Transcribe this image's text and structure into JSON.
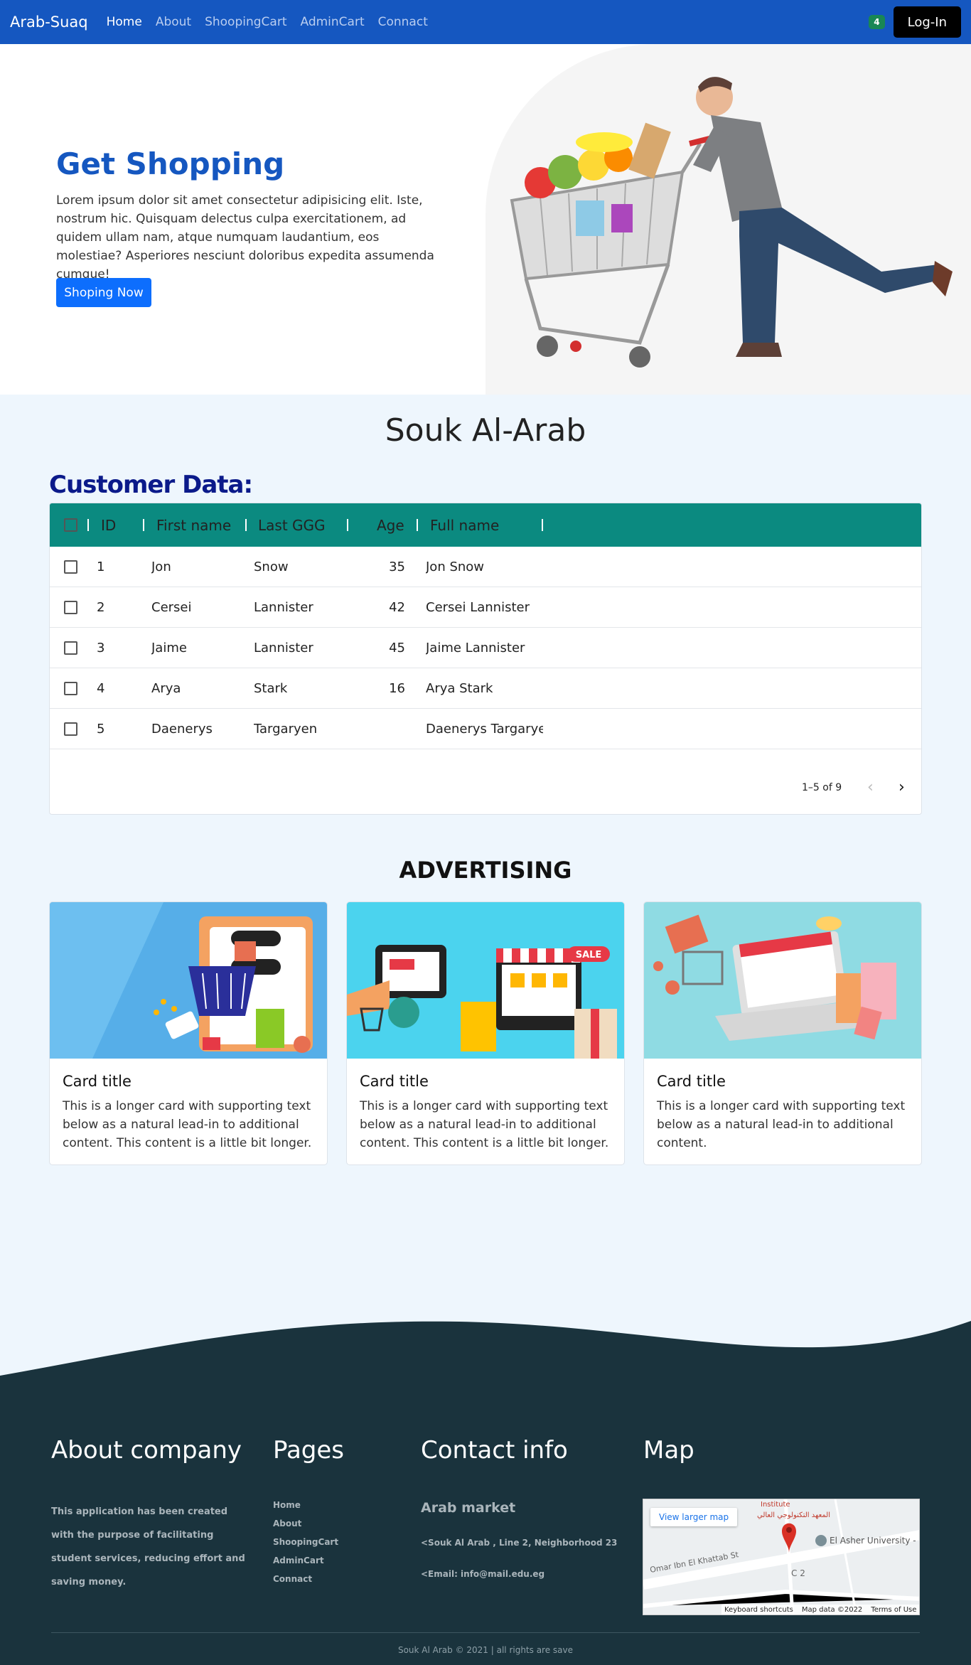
{
  "nav": {
    "brand": "Arab-Suaq",
    "links": [
      "Home",
      "About",
      "ShoopingCart",
      "AdminCart",
      "Connact"
    ],
    "cart_count": "4",
    "login": "Log-In"
  },
  "hero": {
    "title": "Get Shopping",
    "text": "Lorem ipsum dolor sit amet consectetur adipisicing elit. Iste, nostrum hic. Quisquam delectus culpa exercitationem, ad quidem ullam nam, atque numquam laudantium, eos molestiae? Asperiores nesciunt doloribus expedita assumenda cumque!",
    "button": "Shoping Now"
  },
  "section_title": "Souk Al-Arab",
  "customer": {
    "title": "Customer Data:",
    "columns": [
      "ID",
      "First name",
      "Last GGG",
      "Age",
      "Full name"
    ],
    "rows": [
      {
        "id": "1",
        "first": "Jon",
        "last": "Snow",
        "age": "35",
        "full": "Jon Snow"
      },
      {
        "id": "2",
        "first": "Cersei",
        "last": "Lannister",
        "age": "42",
        "full": "Cersei Lannister"
      },
      {
        "id": "3",
        "first": "Jaime",
        "last": "Lannister",
        "age": "45",
        "full": "Jaime Lannister"
      },
      {
        "id": "4",
        "first": "Arya",
        "last": "Stark",
        "age": "16",
        "full": "Arya Stark"
      },
      {
        "id": "5",
        "first": "Daenerys",
        "last": "Targaryen",
        "age": "",
        "full": "Daenerys Targaryen"
      }
    ],
    "pagination": "1–5 of 9"
  },
  "advertising": {
    "title": "ADVERTISING",
    "cards": [
      {
        "title": "Card title",
        "text": "This is a longer card with supporting text below as a natural lead-in to additional content. This content is a little bit longer.",
        "image": "shopping-basket-illustration"
      },
      {
        "title": "Card title",
        "text": "This is a longer card with supporting text below as a natural lead-in to additional content. This content is a little bit longer.",
        "image": "online-store-illustration",
        "badge": "SALE"
      },
      {
        "title": "Card title",
        "text": "This is a longer card with supporting text below as a natural lead-in to additional content.",
        "image": "laptop-shopping-illustration"
      }
    ]
  },
  "footer": {
    "about_heading": "About company",
    "about_text": "This application has been created with the purpose of facilitating student services, reducing effort and saving money.",
    "pages_heading": "Pages",
    "pages": [
      "Home",
      "About",
      "ShoopingCart",
      "AdminCart",
      "Connact"
    ],
    "contact_heading": "Contact info",
    "contact_name": "Arab market",
    "address": "<Souk Al Arab , Line 2, Neighborhood 23",
    "email": "<Email: info@mail.edu.eg",
    "map_heading": "Map",
    "map": {
      "larger": "View larger map",
      "place_ar": "المعهد التكنولوجي العالي",
      "place_top": "Institute",
      "uni": "El Asher University - EAU",
      "street": "Omar Ibn El Khattab St",
      "c2": "C 2",
      "shortcuts": "Keyboard shortcuts",
      "mapdata": "Map data ©2022",
      "terms": "Terms of Use"
    },
    "copyright": "Souk Al Arab © 2021 | all rights are save"
  },
  "colors": {
    "primary": "#1557c0",
    "header_teal": "#0b8a80",
    "footer": "#1a333d",
    "badge": "#198754"
  }
}
